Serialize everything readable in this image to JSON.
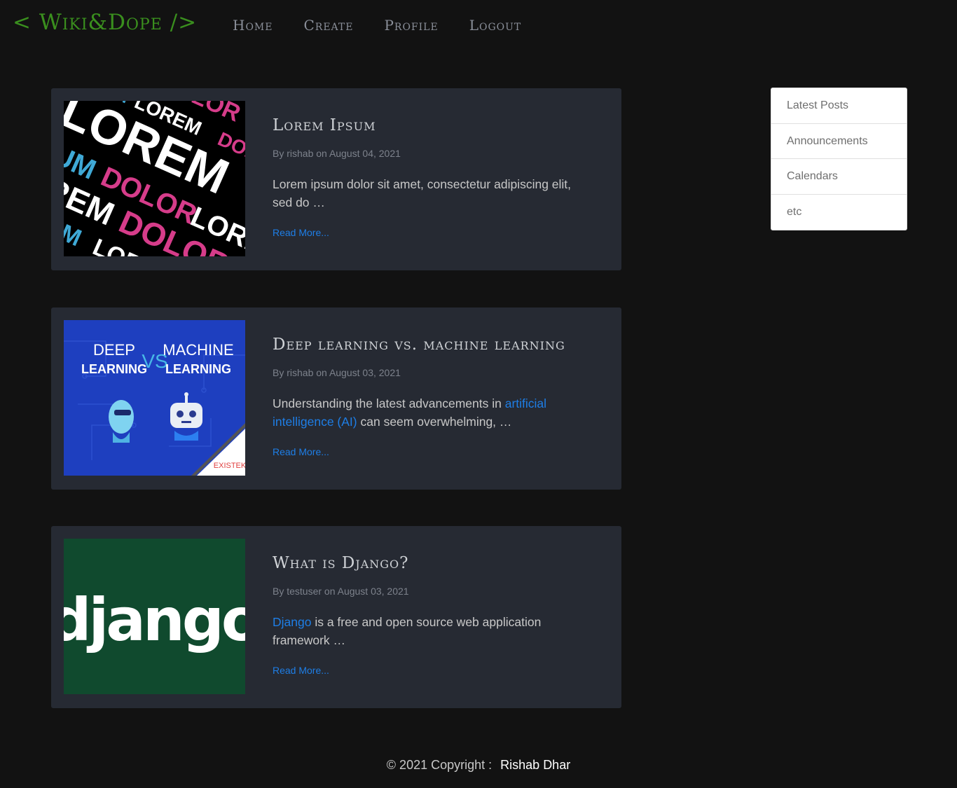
{
  "brand": {
    "text": "< Wiki&Dope />"
  },
  "nav": {
    "items": [
      {
        "label": "Home"
      },
      {
        "label": "Create"
      },
      {
        "label": "Profile"
      },
      {
        "label": "Logout"
      }
    ]
  },
  "posts": [
    {
      "title": "Lorem Ipsum",
      "meta": "By rishab on August 04, 2021",
      "excerpt": "Lorem ipsum dolor sit amet, consectetur adipiscing elit, sed do …",
      "read_more": "Read More...",
      "image": {
        "words": [
          "LOREM",
          "IPSUM",
          "DOLOR"
        ]
      }
    },
    {
      "title": "Deep learning vs. machine learning",
      "meta": "By rishab on August 03, 2021",
      "excerpt_before": "Understanding the latest advancements in ",
      "excerpt_link": "artificial intelligence (AI)",
      "excerpt_after": " can seem overwhelming, …",
      "read_more": "Read More...",
      "image": {
        "left_top": "DEEP",
        "left_bottom": "LEARNING",
        "vs": "VS",
        "right_top": "MACHINE",
        "right_bottom": "LEARNING",
        "brand": "EXISTEK"
      }
    },
    {
      "title": "What is Django?",
      "meta": "By testuser on August 03, 2021",
      "excerpt_link": "Django",
      "excerpt_after": " is a free and open source web application framework …",
      "read_more": "Read More...",
      "image": {
        "logo": "django"
      }
    }
  ],
  "sidebar": {
    "items": [
      {
        "label": "Latest Posts"
      },
      {
        "label": "Announcements"
      },
      {
        "label": "Calendars"
      },
      {
        "label": "etc"
      }
    ]
  },
  "footer": {
    "copyright": "© 2021 Copyright :",
    "author": "Rishab Dhar"
  }
}
